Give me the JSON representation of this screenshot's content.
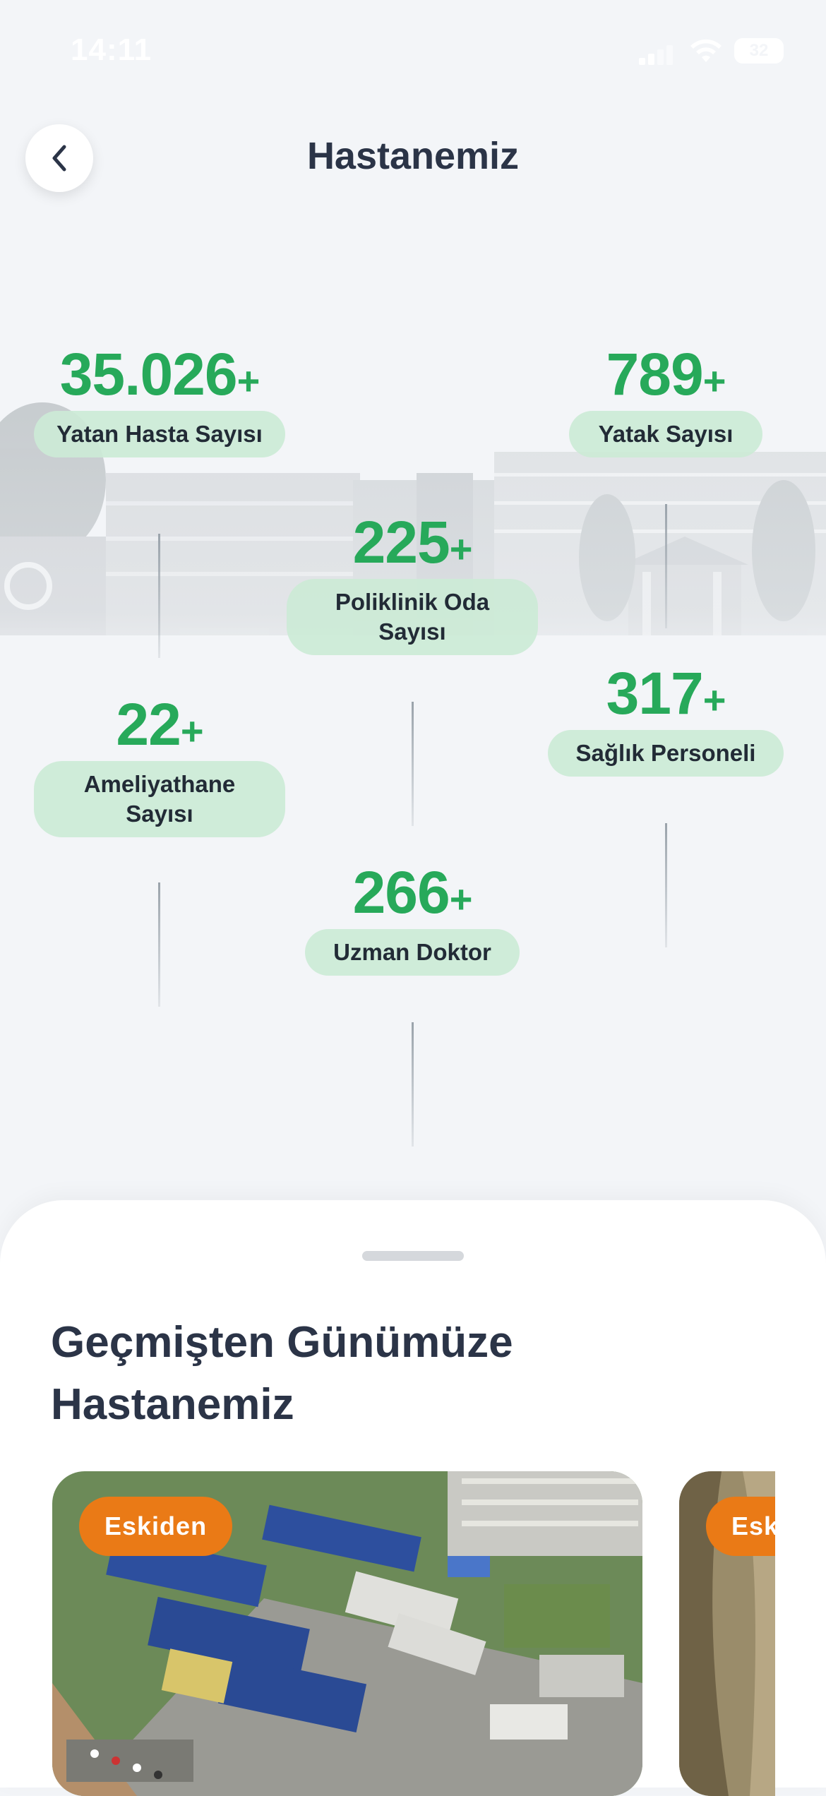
{
  "status_bar": {
    "time": "14:11",
    "battery": "32"
  },
  "header": {
    "title": "Hastanemiz"
  },
  "stats": [
    {
      "value": "35.026",
      "suffix": "+",
      "label": "Yatan Hasta Sayısı"
    },
    {
      "value": "789",
      "suffix": "+",
      "label": "Yatak Sayısı"
    },
    {
      "value": "225",
      "suffix": "+",
      "label": "Poliklinik Oda Sayısı"
    },
    {
      "value": "22",
      "suffix": "+",
      "label": "Ameliyathane Sayısı"
    },
    {
      "value": "317",
      "suffix": "+",
      "label": "Sağlık Personeli"
    },
    {
      "value": "266",
      "suffix": "+",
      "label": "Uzman Doktor"
    }
  ],
  "history": {
    "title": "Geçmişten Günümüze Hastanemiz",
    "cards": [
      {
        "badge": "Eskiden"
      },
      {
        "badge": "Esk"
      }
    ]
  },
  "colors": {
    "accent_green": "#27a95a",
    "label_bg": "#cceAd6",
    "badge_orange": "#ea7a16",
    "text_dark": "#2b3447"
  }
}
